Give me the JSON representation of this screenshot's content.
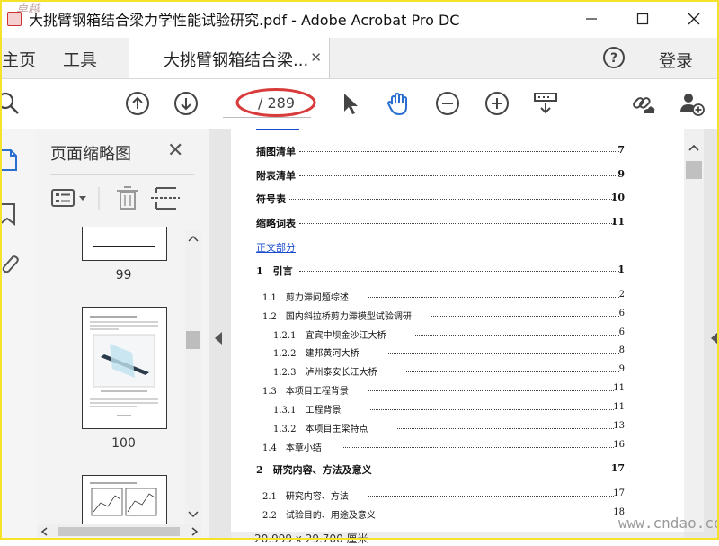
{
  "window": {
    "title": "大挑臂钢箱结合梁力学性能试验研究.pdf - Adobe Acrobat Pro DC",
    "corner_watermark": "卓越"
  },
  "tabs": {
    "home": "主页",
    "tools": "工具",
    "document": "大挑臂钢箱结合梁...",
    "login": "登录"
  },
  "toolbar": {
    "page_total": "/ 289",
    "accent": "#2a6fcf",
    "highlight": "#d83b3b"
  },
  "panel": {
    "title": "页面缩略图",
    "thumbnails": [
      {
        "label": "99"
      },
      {
        "label": "100"
      }
    ]
  },
  "toc": [
    {
      "text": "插图清单",
      "page": "7",
      "level": "big"
    },
    {
      "text": "附表清单",
      "page": "9",
      "level": "big"
    },
    {
      "text": "符号表",
      "page": "10",
      "level": "big"
    },
    {
      "text": "缩略词表",
      "page": "11",
      "level": "big"
    },
    {
      "text": "正文部分",
      "page": "",
      "level": "link"
    },
    {
      "text": "1　引言",
      "page": "1",
      "level": "big"
    },
    {
      "text": "1.1　剪力滞问题综述",
      "page": "2",
      "level": "l1"
    },
    {
      "text": "1.2　国内斜拉桥剪力滞模型试验调研",
      "page": "6",
      "level": "l1"
    },
    {
      "text": "1.2.1　宜宾中坝金沙江大桥",
      "page": "6",
      "level": "l2"
    },
    {
      "text": "1.2.2　建邦黄河大桥",
      "page": "8",
      "level": "l2"
    },
    {
      "text": "1.2.3　泸州泰安长江大桥",
      "page": "9",
      "level": "l2"
    },
    {
      "text": "1.3　本项目工程背景",
      "page": "11",
      "level": "l1"
    },
    {
      "text": "1.3.1　工程背景",
      "page": "11",
      "level": "l2"
    },
    {
      "text": "1.3.2　本项目主梁特点",
      "page": "13",
      "level": "l2"
    },
    {
      "text": "1.4　本章小结",
      "page": "16",
      "level": "l1"
    },
    {
      "text": "2　研究内容、方法及意义",
      "page": "17",
      "level": "big"
    },
    {
      "text": "2.1　研究内容、方法",
      "page": "17",
      "level": "l1"
    },
    {
      "text": "2.2　试验目的、用途及意义",
      "page": "18",
      "level": "l1"
    }
  ],
  "status": {
    "page_size": "20.999 x 29.700 厘米"
  },
  "watermark": "www.cndao.com"
}
